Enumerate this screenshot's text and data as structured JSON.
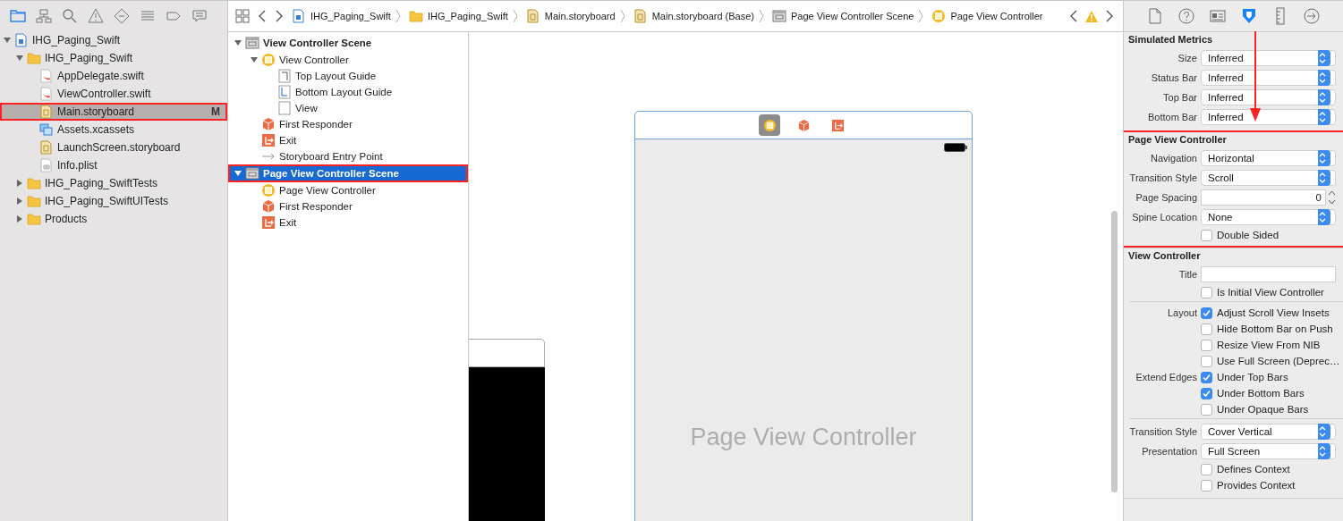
{
  "navigator": {
    "tabs": [
      {
        "kind": "folder",
        "selected": true
      },
      {
        "kind": "hierarchy",
        "selected": false
      },
      {
        "kind": "search",
        "selected": false
      },
      {
        "kind": "warning",
        "selected": false
      },
      {
        "kind": "diamond",
        "selected": false
      },
      {
        "kind": "list",
        "selected": false
      },
      {
        "kind": "tag",
        "selected": false
      },
      {
        "kind": "comment",
        "selected": false
      }
    ],
    "tree": [
      {
        "label": "IHG_Paging_Swift",
        "kind": "project",
        "expanded": true,
        "selected": false,
        "children": [
          {
            "label": "IHG_Paging_Swift",
            "kind": "folder",
            "expanded": true,
            "selected": false,
            "children": [
              {
                "label": "AppDelegate.swift",
                "kind": "swift",
                "selected": false
              },
              {
                "label": "ViewController.swift",
                "kind": "swift",
                "selected": false
              },
              {
                "label": "Main.storyboard",
                "kind": "storyboard",
                "selected": true,
                "badge": "M",
                "annotated": true
              },
              {
                "label": "Assets.xcassets",
                "kind": "assets",
                "selected": false
              },
              {
                "label": "LaunchScreen.storyboard",
                "kind": "storyboard",
                "selected": false
              },
              {
                "label": "Info.plist",
                "kind": "plist",
                "selected": false
              }
            ]
          },
          {
            "label": "IHG_Paging_SwiftTests",
            "kind": "folder",
            "expanded": false,
            "selected": false
          },
          {
            "label": "IHG_Paging_SwiftUITests",
            "kind": "folder",
            "expanded": false,
            "selected": false
          },
          {
            "label": "Products",
            "kind": "folder",
            "expanded": false,
            "selected": false
          }
        ]
      }
    ]
  },
  "jump_bar": {
    "crumbs": [
      {
        "kind": "project",
        "label": "IHG_Paging_Swift"
      },
      {
        "kind": "folder",
        "label": "IHG_Paging_Swift"
      },
      {
        "kind": "storyboard",
        "label": "Main.storyboard"
      },
      {
        "kind": "storyboard",
        "label": "Main.storyboard (Base)"
      },
      {
        "kind": "scene",
        "label": "Page View Controller Scene"
      },
      {
        "kind": "controller",
        "label": "Page View Controller"
      }
    ]
  },
  "outline": [
    {
      "label": "View Controller Scene",
      "kind": "scene",
      "expanded": true,
      "selected": false,
      "children": [
        {
          "label": "View Controller",
          "kind": "controller",
          "expanded": true,
          "selected": false,
          "children": [
            {
              "label": "Top Layout Guide",
              "kind": "guide-top",
              "selected": false
            },
            {
              "label": "Bottom Layout Guide",
              "kind": "guide-bottom",
              "selected": false
            },
            {
              "label": "View",
              "kind": "view",
              "selected": false
            }
          ]
        },
        {
          "label": "First Responder",
          "kind": "responder",
          "selected": false
        },
        {
          "label": "Exit",
          "kind": "exit",
          "selected": false
        },
        {
          "label": "Storyboard Entry Point",
          "kind": "entry",
          "selected": false
        }
      ]
    },
    {
      "label": "Page View Controller Scene",
      "kind": "scene",
      "expanded": true,
      "selected": true,
      "annotated": true,
      "children": [
        {
          "label": "Page View Controller",
          "kind": "controller",
          "selected": false
        },
        {
          "label": "First Responder",
          "kind": "responder",
          "selected": false
        },
        {
          "label": "Exit",
          "kind": "exit",
          "selected": false
        }
      ]
    }
  ],
  "canvas": {
    "scene_label": "Page View Controller",
    "dock": [
      {
        "kind": "controller",
        "selected": true
      },
      {
        "kind": "responder",
        "selected": false
      },
      {
        "kind": "exit",
        "selected": false
      }
    ]
  },
  "inspector": {
    "tabs": [
      {
        "kind": "file",
        "selected": false
      },
      {
        "kind": "help",
        "selected": false
      },
      {
        "kind": "identity",
        "selected": false
      },
      {
        "kind": "attributes",
        "selected": true
      },
      {
        "kind": "size",
        "selected": false
      },
      {
        "kind": "connections",
        "selected": false
      }
    ],
    "sections": [
      {
        "title": "Simulated Metrics",
        "groups": [
          [
            {
              "kind": "popup",
              "label": "Size",
              "value": "Inferred"
            },
            {
              "kind": "popup",
              "label": "Status Bar",
              "value": "Inferred"
            },
            {
              "kind": "popup",
              "label": "Top Bar",
              "value": "Inferred"
            },
            {
              "kind": "popup",
              "label": "Bottom Bar",
              "value": "Inferred"
            }
          ]
        ]
      },
      {
        "title": "Page View Controller",
        "annotated": true,
        "groups": [
          [
            {
              "kind": "popup",
              "label": "Navigation",
              "value": "Horizontal"
            },
            {
              "kind": "popup",
              "label": "Transition Style",
              "value": "Scroll"
            },
            {
              "kind": "stepper",
              "label": "Page Spacing",
              "value": "0"
            },
            {
              "kind": "popup",
              "label": "Spine Location",
              "value": "None"
            },
            {
              "kind": "checkbox",
              "text": "Double Sided",
              "checked": false
            }
          ]
        ]
      },
      {
        "title": "View Controller",
        "groups": [
          [
            {
              "kind": "field",
              "label": "Title"
            },
            {
              "kind": "checkbox",
              "text": "Is Initial View Controller",
              "checked": false
            }
          ],
          [
            {
              "kind": "checkbox",
              "label": "Layout",
              "text": "Adjust Scroll View Insets",
              "checked": true
            },
            {
              "kind": "checkbox",
              "text": "Hide Bottom Bar on Push",
              "checked": false
            },
            {
              "kind": "checkbox",
              "text": "Resize View From NIB",
              "checked": false
            },
            {
              "kind": "checkbox",
              "text": "Use Full Screen (Deprec…",
              "checked": false
            },
            {
              "kind": "checkbox",
              "label": "Extend Edges",
              "text": "Under Top Bars",
              "checked": true
            },
            {
              "kind": "checkbox",
              "text": "Under Bottom Bars",
              "checked": true
            },
            {
              "kind": "checkbox",
              "text": "Under Opaque Bars",
              "checked": false
            }
          ],
          [
            {
              "kind": "popup",
              "label": "Transition Style",
              "value": "Cover Vertical"
            },
            {
              "kind": "popup",
              "label": "Presentation",
              "value": "Full Screen"
            },
            {
              "kind": "checkbox",
              "text": "Defines Context",
              "checked": false
            },
            {
              "kind": "checkbox",
              "text": "Provides Context",
              "checked": false
            }
          ]
        ]
      }
    ]
  }
}
